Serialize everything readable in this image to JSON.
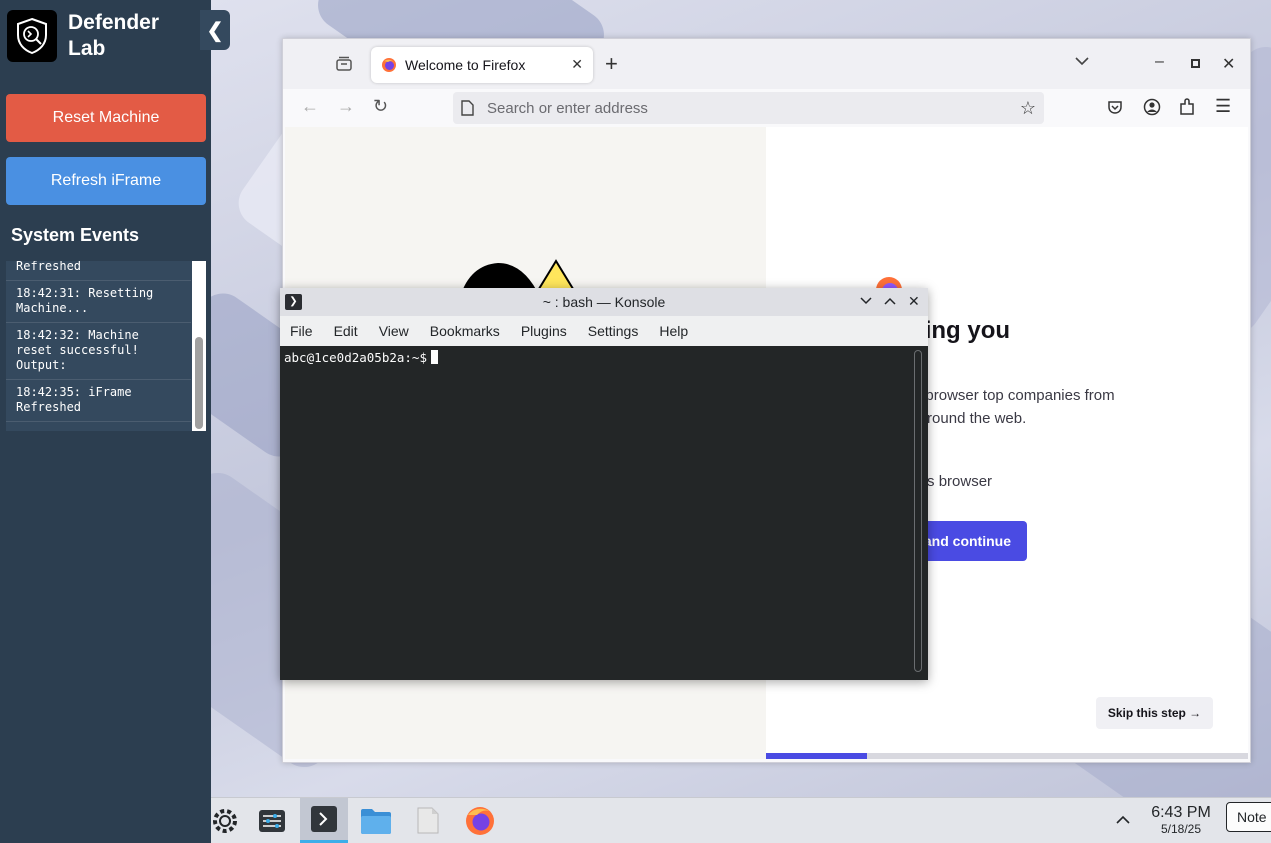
{
  "sidebar": {
    "brand_title": "Defender Lab",
    "collapse_glyph": "❮",
    "reset_button": "Reset Machine",
    "refresh_button": "Refresh iFrame",
    "events_heading": "System Events",
    "events": [
      "Refreshed",
      "18:42:31: Resetting\nMachine...",
      "18:42:32: Machine\nreset successful!\nOutput:",
      "18:42:35: iFrame\nRefreshed"
    ]
  },
  "firefox": {
    "tab_title": "Welcome to Firefox",
    "tab_close": "✕",
    "new_tab": "+",
    "url_placeholder": "Search or enter address",
    "welcome_heading": "ove keeping you",
    "welcome_body": "n-profit backed browser top companies from secretly g you around the web.",
    "import_text": "ort from previous browser",
    "primary_button": "and continue",
    "skip_button": "Skip this step →",
    "progress_fraction": 0.21
  },
  "konsole": {
    "title": "~ : bash — Konsole",
    "menu": [
      "File",
      "Edit",
      "View",
      "Bookmarks",
      "Plugins",
      "Settings",
      "Help"
    ],
    "prompt": "abc@1ce0d2a05b2a:~$"
  },
  "taskbar": {
    "time": "6:43 PM",
    "date": "5/18/25",
    "note_label": "Note",
    "active_app": "konsole"
  },
  "colors": {
    "sidebar_bg": "#2c3e50",
    "reset_btn": "#e35b45",
    "refresh_btn": "#4a90e2",
    "firefox_accent": "#4a4be3",
    "terminal_bg": "#232627"
  }
}
